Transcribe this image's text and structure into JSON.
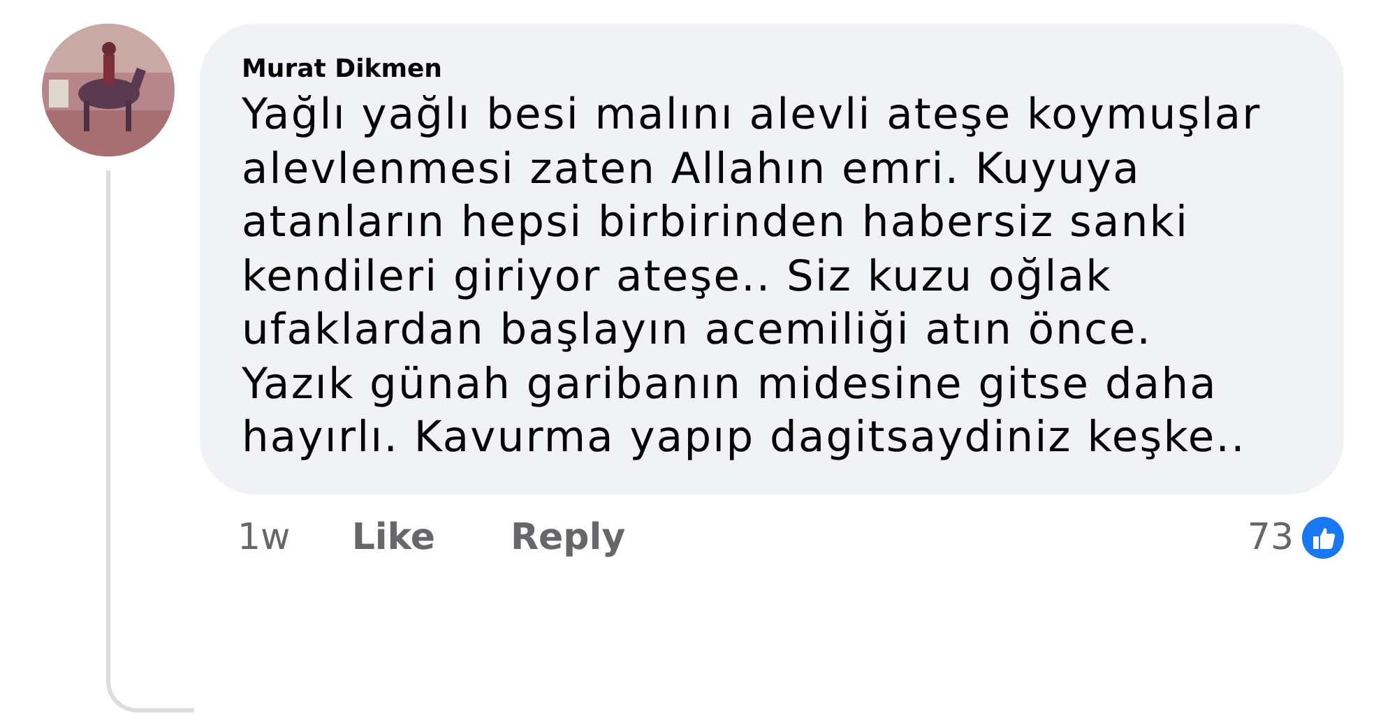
{
  "comment": {
    "author": "Murat Dikmen",
    "text": "Yağlı yağlı besi malını alevli ateşe koymuşlar\nalevlenmesi zaten Allahın emri. Kuyuya\natanların hepsi birbirinden habersiz sanki\nkendileri giriyor ateşe.. Siz kuzu oğlak\nufaklardan başlayın acemiliği atın önce.\nYazık günah garibanın midesine gitse daha\nhayırlı. Kavurma yapıp dagitsaydiniz keşke..",
    "time": "1w",
    "actions": [
      "Like",
      "Reply"
    ],
    "reaction_count": "73"
  }
}
